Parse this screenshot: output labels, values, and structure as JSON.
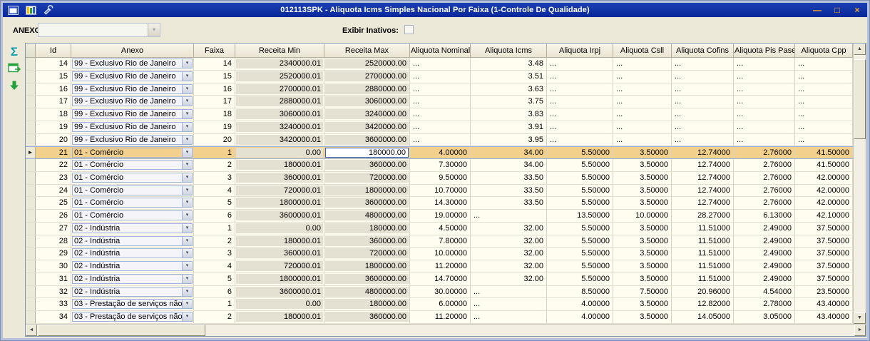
{
  "window": {
    "title": "012113SPK - Aliquota Icms Simples Nacional Por Faixa (1-Controle De Qualidade)",
    "controls": {
      "minimize": "—",
      "maximize": "□",
      "close": "×"
    }
  },
  "icons": {
    "combo_arrow": "▾",
    "row_pointer": "►",
    "scroll_up": "▲",
    "scroll_down": "▼",
    "scroll_left": "◄",
    "scroll_right": "►"
  },
  "filter_bar": {
    "anexo_label": "ANEXO:",
    "anexo_value": "",
    "exibir_inativos_label": "Exibir Inativos:",
    "exibir_inativos_checked": false
  },
  "side_toolbar": {
    "sum_symbol": "Σ"
  },
  "grid": {
    "columns": [
      "Id",
      "Anexo",
      "Faixa",
      "Receita Min",
      "Receita Max",
      "Aliquota Nominal",
      "Aliquota Icms",
      "Aliquota Irpj",
      "Aliquota Csll",
      "Aliquota Cofins",
      "Aliquota Pis Pasep",
      "Aliquota Cpp"
    ],
    "selected_id": "21",
    "rows": [
      [
        "14",
        "99 - Exclusivo Rio de Janeiro",
        "14",
        "2340000.01",
        "2520000.00",
        "...",
        "3.48",
        "...",
        "...",
        "...",
        "...",
        "..."
      ],
      [
        "15",
        "99 - Exclusivo Rio de Janeiro",
        "15",
        "2520000.01",
        "2700000.00",
        "...",
        "3.51",
        "...",
        "...",
        "...",
        "...",
        "..."
      ],
      [
        "16",
        "99 - Exclusivo Rio de Janeiro",
        "16",
        "2700000.01",
        "2880000.00",
        "...",
        "3.63",
        "...",
        "...",
        "...",
        "...",
        "..."
      ],
      [
        "17",
        "99 - Exclusivo Rio de Janeiro",
        "17",
        "2880000.01",
        "3060000.00",
        "...",
        "3.75",
        "...",
        "...",
        "...",
        "...",
        "..."
      ],
      [
        "18",
        "99 - Exclusivo Rio de Janeiro",
        "18",
        "3060000.01",
        "3240000.00",
        "...",
        "3.83",
        "...",
        "...",
        "...",
        "...",
        "..."
      ],
      [
        "19",
        "99 - Exclusivo Rio de Janeiro",
        "19",
        "3240000.01",
        "3420000.00",
        "...",
        "3.91",
        "...",
        "...",
        "...",
        "...",
        "..."
      ],
      [
        "20",
        "99 - Exclusivo Rio de Janeiro",
        "20",
        "3420000.01",
        "3600000.00",
        "...",
        "3.95",
        "...",
        "...",
        "...",
        "...",
        "..."
      ],
      [
        "21",
        "01 - Comércio",
        "1",
        "0.00",
        "180000.00",
        "4.00000",
        "34.00",
        "5.50000",
        "3.50000",
        "12.74000",
        "2.76000",
        "41.50000"
      ],
      [
        "22",
        "01 - Comércio",
        "2",
        "180000.01",
        "360000.00",
        "7.30000",
        "34.00",
        "5.50000",
        "3.50000",
        "12.74000",
        "2.76000",
        "41.50000"
      ],
      [
        "23",
        "01 - Comércio",
        "3",
        "360000.01",
        "720000.00",
        "9.50000",
        "33.50",
        "5.50000",
        "3.50000",
        "12.74000",
        "2.76000",
        "42.00000"
      ],
      [
        "24",
        "01 - Comércio",
        "4",
        "720000.01",
        "1800000.00",
        "10.70000",
        "33.50",
        "5.50000",
        "3.50000",
        "12.74000",
        "2.76000",
        "42.00000"
      ],
      [
        "25",
        "01 - Comércio",
        "5",
        "1800000.01",
        "3600000.00",
        "14.30000",
        "33.50",
        "5.50000",
        "3.50000",
        "12.74000",
        "2.76000",
        "42.00000"
      ],
      [
        "26",
        "01 - Comércio",
        "6",
        "3600000.01",
        "4800000.00",
        "19.00000",
        "...",
        "13.50000",
        "10.00000",
        "28.27000",
        "6.13000",
        "42.10000"
      ],
      [
        "27",
        "02 - Indústria",
        "1",
        "0.00",
        "180000.00",
        "4.50000",
        "32.00",
        "5.50000",
        "3.50000",
        "11.51000",
        "2.49000",
        "37.50000"
      ],
      [
        "28",
        "02 - Indústria",
        "2",
        "180000.01",
        "360000.00",
        "7.80000",
        "32.00",
        "5.50000",
        "3.50000",
        "11.51000",
        "2.49000",
        "37.50000"
      ],
      [
        "29",
        "02 - Indústria",
        "3",
        "360000.01",
        "720000.00",
        "10.00000",
        "32.00",
        "5.50000",
        "3.50000",
        "11.51000",
        "2.49000",
        "37.50000"
      ],
      [
        "30",
        "02 - Indústria",
        "4",
        "720000.01",
        "1800000.00",
        "11.20000",
        "32.00",
        "5.50000",
        "3.50000",
        "11.51000",
        "2.49000",
        "37.50000"
      ],
      [
        "31",
        "02 - Indústria",
        "5",
        "1800000.01",
        "3600000.00",
        "14.70000",
        "32.00",
        "5.50000",
        "3.50000",
        "11.51000",
        "2.49000",
        "37.50000"
      ],
      [
        "32",
        "02 - Indústria",
        "6",
        "3600000.01",
        "4800000.00",
        "30.00000",
        "...",
        "8.50000",
        "7.50000",
        "20.96000",
        "4.54000",
        "23.50000"
      ],
      [
        "33",
        "03 - Prestação de serviços não",
        "1",
        "0.00",
        "180000.00",
        "6.00000",
        "...",
        "4.00000",
        "3.50000",
        "12.82000",
        "2.78000",
        "43.40000"
      ],
      [
        "34",
        "03 - Prestação de serviços não",
        "2",
        "180000.01",
        "360000.00",
        "11.20000",
        "...",
        "4.00000",
        "3.50000",
        "14.05000",
        "3.05000",
        "43.40000"
      ]
    ]
  },
  "colors": {
    "titlebar-blue": "#07279a",
    "window-frame": "#b6c2dd",
    "panel-beige": "#ece9d8",
    "grid-cream": "#fffdf0",
    "selected-row": "#f3d08c",
    "focus-blue": "#2f62c8",
    "control-orange": "#ffaa28",
    "icon-teal": "#0d9aa8",
    "icon-green": "#24a13c"
  }
}
